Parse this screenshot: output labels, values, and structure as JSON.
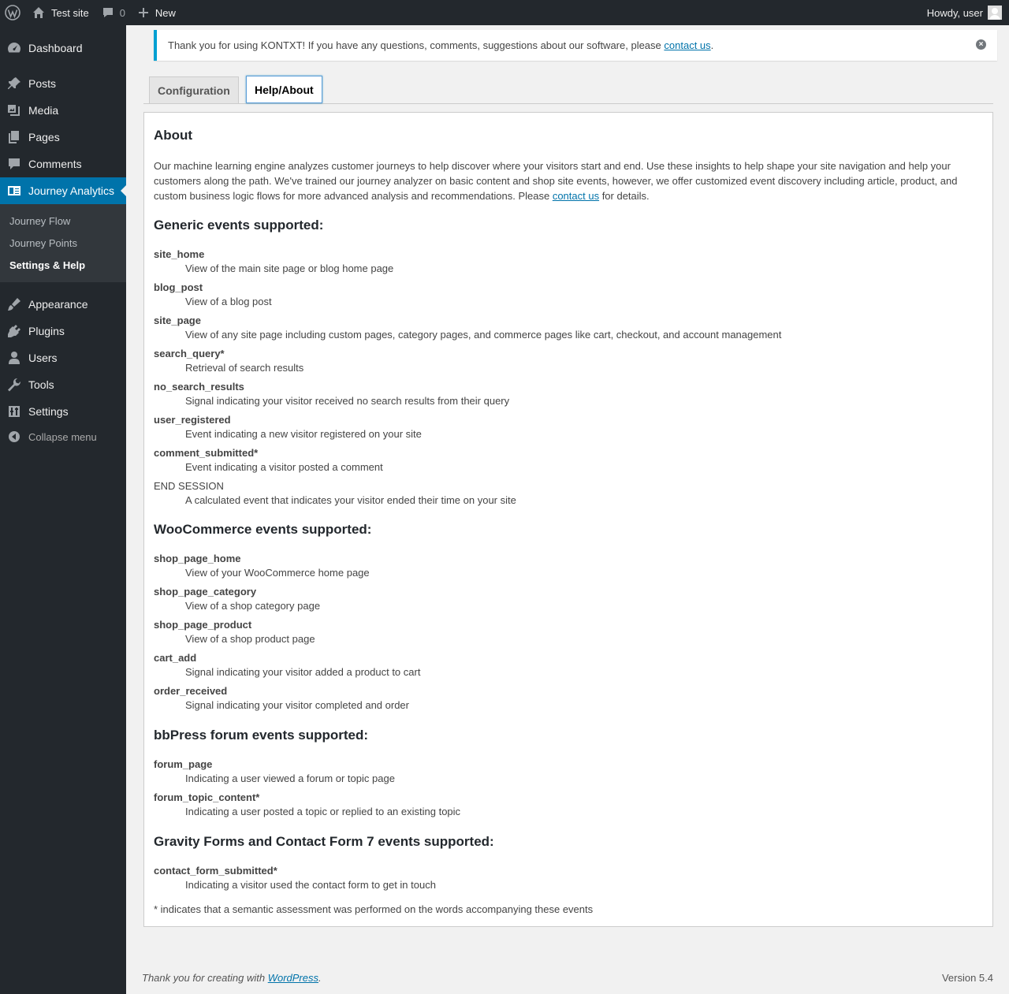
{
  "admin_bar": {
    "site_name": "Test site",
    "comments_count": "0",
    "new_label": "New",
    "howdy": "Howdy, user"
  },
  "sidebar": {
    "items": [
      {
        "label": "Dashboard",
        "icon": "dashboard-icon"
      },
      {
        "label": "Posts",
        "icon": "pin-icon"
      },
      {
        "label": "Media",
        "icon": "media-icon"
      },
      {
        "label": "Pages",
        "icon": "pages-icon"
      },
      {
        "label": "Comments",
        "icon": "comment-icon"
      },
      {
        "label": "Journey Analytics",
        "icon": "analytics-icon"
      },
      {
        "label": "Appearance",
        "icon": "brush-icon"
      },
      {
        "label": "Plugins",
        "icon": "plug-icon"
      },
      {
        "label": "Users",
        "icon": "user-icon"
      },
      {
        "label": "Tools",
        "icon": "wrench-icon"
      },
      {
        "label": "Settings",
        "icon": "sliders-icon"
      }
    ],
    "submenu": [
      "Journey Flow",
      "Journey Points",
      "Settings & Help"
    ],
    "collapse": "Collapse menu"
  },
  "notice": {
    "text": "Thank you for using KONTXT! If you have any questions, comments, suggestions about our software, please ",
    "link": "contact us",
    "end": "."
  },
  "tabs": [
    "Configuration",
    "Help/About"
  ],
  "about": {
    "title": "About",
    "text": "Our machine learning engine analyzes customer journeys to help discover where your visitors start and end. Use these insights to help shape your site navigation and help your customers along the path. We've trained our journey analyzer on basic content and shop site events, however, we offer customized event discovery including article, product, and custom business logic flows for more advanced analysis and recommendations. Please ",
    "link": "contact us",
    "end": " for details."
  },
  "sections": [
    {
      "title": "Generic events supported:",
      "events": [
        {
          "name": "site_home",
          "desc": "View of the main site page or blog home page"
        },
        {
          "name": "blog_post",
          "desc": "View of a blog post"
        },
        {
          "name": "site_page",
          "desc": "View of any site page including custom pages, category pages, and commerce pages like cart, checkout, and account management"
        },
        {
          "name": "search_query*",
          "desc": "Retrieval of search results"
        },
        {
          "name": "no_search_results",
          "desc": "Signal indicating your visitor received no search results from their query"
        },
        {
          "name": "user_registered",
          "desc": "Event indicating a new visitor registered on your site"
        },
        {
          "name": "comment_submitted*",
          "desc": "Event indicating a visitor posted a comment"
        },
        {
          "name": "END SESSION",
          "desc": "A calculated event that indicates your visitor ended their time on your site"
        }
      ]
    },
    {
      "title": "WooCommerce events supported:",
      "events": [
        {
          "name": "shop_page_home",
          "desc": "View of your WooCommerce home page"
        },
        {
          "name": "shop_page_category",
          "desc": "View of a shop category page"
        },
        {
          "name": "shop_page_product",
          "desc": "View of a shop product page"
        },
        {
          "name": "cart_add",
          "desc": "Signal indicating your visitor added a product to cart"
        },
        {
          "name": "order_received",
          "desc": "Signal indicating your visitor completed and order"
        }
      ]
    },
    {
      "title": "bbPress forum events supported:",
      "events": [
        {
          "name": "forum_page",
          "desc": "Indicating a user viewed a forum or topic page"
        },
        {
          "name": "forum_topic_content*",
          "desc": "Indicating a user posted a topic or replied to an existing topic"
        }
      ]
    },
    {
      "title": "Gravity Forms and Contact Form 7 events supported:",
      "events": [
        {
          "name": "contact_form_submitted*",
          "desc": "Indicating a visitor used the contact form to get in touch"
        }
      ]
    }
  ],
  "footnote": "* indicates that a semantic assessment was performed on the words accompanying these events",
  "footer": {
    "text": "Thank you for creating with ",
    "link": "WordPress",
    "end": ".",
    "version": "Version 5.4"
  },
  "colors": {
    "admin_bg": "#23282d",
    "accent": "#0073aa",
    "notice_border": "#00a0d2"
  }
}
